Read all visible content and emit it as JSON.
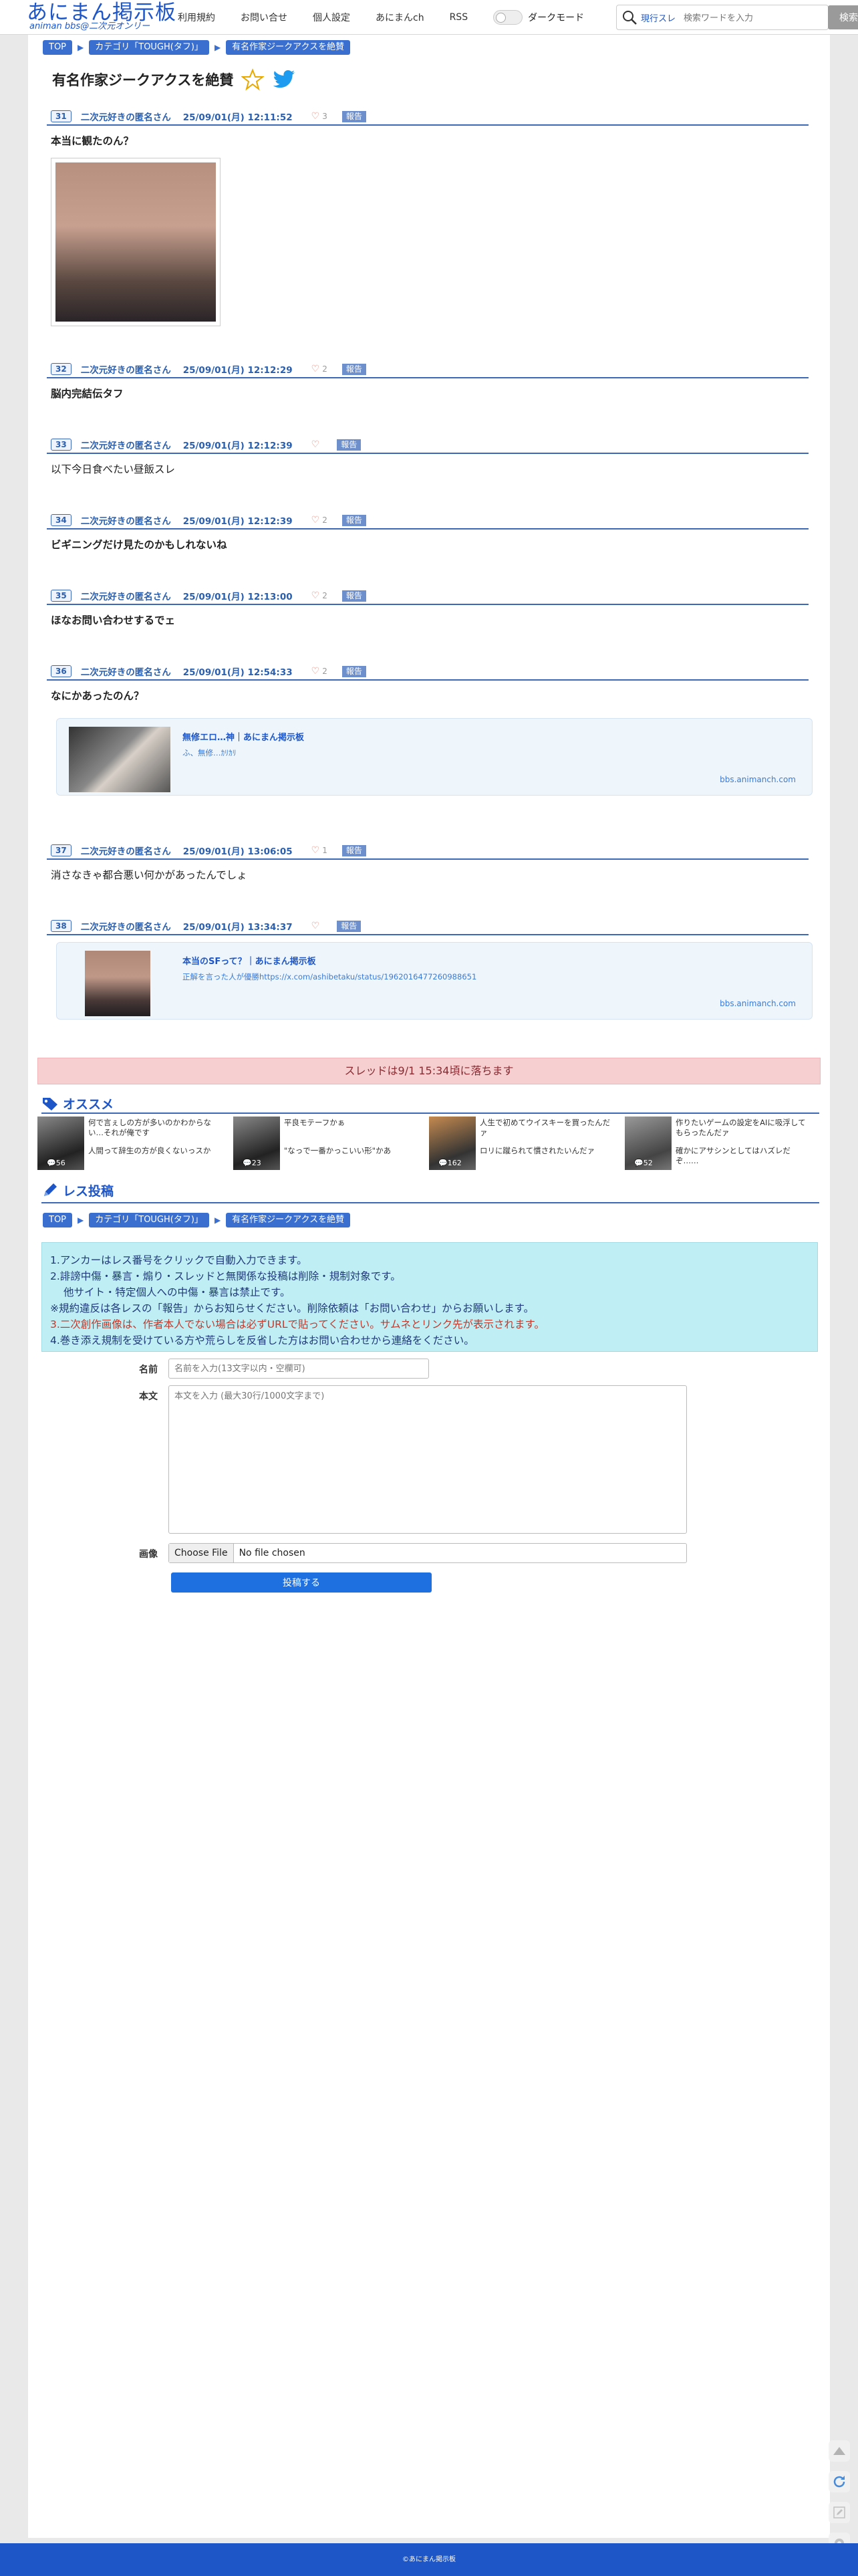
{
  "header": {
    "logo_main": "あにまん掲示板",
    "logo_sub": "animan bbs@二次元オンリー",
    "nav": [
      "利用規約",
      "お問い合せ",
      "個人設定",
      "あにまんch",
      "RSS"
    ],
    "dark_mode_label": "ダークモード",
    "search_scope": "現行スレ",
    "search_placeholder": "検索ワードを入力",
    "search_button": "検索"
  },
  "breadcrumbs": [
    "TOP",
    "カテゴリ「TOUGH(タフ)」",
    "有名作家ジークアクスを絶賛"
  ],
  "thread_title": "有名作家ジークアクスを絶賛",
  "report_label": "報告",
  "posts": [
    {
      "no": "31",
      "name": "二次元好きの匿名さん",
      "date": "25/09/01(月) 12:11:52",
      "likes": "3",
      "body": "本当に観たのん？",
      "bold": true
    },
    {
      "no": "32",
      "name": "二次元好きの匿名さん",
      "date": "25/09/01(月) 12:12:29",
      "likes": "2",
      "body": "脳内完結伝タフ",
      "bold": true
    },
    {
      "no": "33",
      "name": "二次元好きの匿名さん",
      "date": "25/09/01(月) 12:12:39",
      "likes": "",
      "body": "以下今日食べたい昼飯スレ",
      "bold": false
    },
    {
      "no": "34",
      "name": "二次元好きの匿名さん",
      "date": "25/09/01(月) 12:12:39",
      "likes": "2",
      "body": "ビギニングだけ見たのかもしれないね",
      "bold": true
    },
    {
      "no": "35",
      "name": "二次元好きの匿名さん",
      "date": "25/09/01(月) 12:13:00",
      "likes": "2",
      "body": "ほなお問い合わせするでェ",
      "bold": true
    },
    {
      "no": "36",
      "name": "二次元好きの匿名さん",
      "date": "25/09/01(月) 12:54:33",
      "likes": "2",
      "body": "なにかあったのん？",
      "bold": true
    },
    {
      "no": "37",
      "name": "二次元好きの匿名さん",
      "date": "25/09/01(月) 13:06:05",
      "likes": "1",
      "body": "消さなきゃ都合悪い何かがあったんでしょ",
      "bold": false
    },
    {
      "no": "38",
      "name": "二次元好きの匿名さん",
      "date": "25/09/01(月) 13:34:37",
      "likes": "",
      "body": "",
      "bold": false
    }
  ],
  "link_cards": [
    {
      "title": "無修エロ…神｜あにまん掲示板",
      "desc": "ふ、無修…ｶﾘｶﾘ",
      "domain": "bbs.animanch.com"
    },
    {
      "title": "本当のSFって？｜あにまん掲示板",
      "desc": "正解を言った人が優勝https://x.com/ashibetaku/status/1962016477260988651",
      "domain": "bbs.animanch.com"
    }
  ],
  "fall_notice": "スレッドは9/1 15:34頃に落ちます",
  "recommend_title": "オススメ",
  "recommend": [
    {
      "count": "56",
      "t1": "何で言ぇしの方が多いのかわからない…それが俺です",
      "t2": "人間って辞生の方が良くないっスか"
    },
    {
      "count": "23",
      "t1": "平良モテーフかぁ",
      "t2": "\"なっで一番かっこいい形\"かあ"
    },
    {
      "count": "162",
      "t1": "人生で初めてウイスキーを買ったんだァ",
      "t2": "ロリに蹴られて慣されたいんだァ"
    },
    {
      "count": "52",
      "t1": "作りたいゲームの設定をAIに吸浮してもらったんだァ",
      "t2": "確かにアサシンとしてはハズレだぞ……"
    }
  ],
  "post_form": {
    "title": "レス投稿",
    "rules": [
      "1.アンカーはレス番号をクリックで自動入力できます。",
      "2.誹謗中傷・暴言・煽り・スレッドと無関係な投稿は削除・規制対象です。",
      "他サイト・特定個人への中傷・暴言は禁止です。",
      "※規約違反は各レスの「報告」からお知らせください。削除依頼は「お問い合わせ」からお願いします。",
      "3.二次創作画像は、作者本人でない場合は必ずURLで貼ってください。サムネとリンク先が表示されます。",
      "4.巻き添え規制を受けている方や荒らしを反省した方はお問い合わせから連絡をください。"
    ],
    "name_label": "名前",
    "name_placeholder": "名前を入力(13文字以内・空欄可)",
    "body_label": "本文",
    "body_placeholder": "本文を入力 (最大30行/1000文字まで)",
    "image_label": "画像",
    "file_button": "Choose File",
    "file_status": "No file chosen",
    "submit": "投稿する"
  },
  "footer": "©あにまん掲示板",
  "colors": {
    "brand": "#1e56c8",
    "accent_line": "#3d68b8",
    "notice_bg": "#f6cfd1",
    "rules_bg": "#bfeef4"
  }
}
